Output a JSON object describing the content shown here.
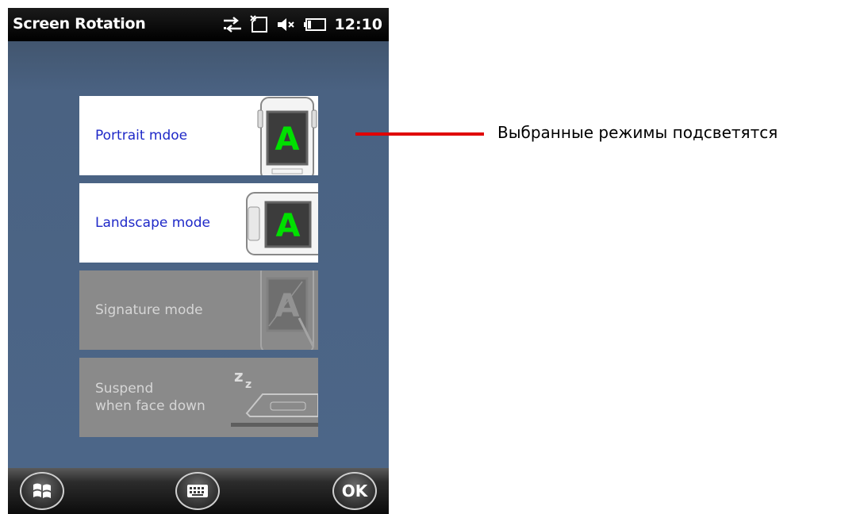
{
  "statusbar": {
    "title": "Screen Rotation",
    "time": "12:10",
    "icons": [
      "connectivity-icon",
      "no-sim-icon",
      "speaker-muted-icon",
      "battery-icon"
    ]
  },
  "modes": [
    {
      "label": "Portrait mdoe",
      "state": "highlighted",
      "art": "portrait-device-icon"
    },
    {
      "label": "Landscape mode",
      "state": "highlighted",
      "art": "landscape-device-icon"
    },
    {
      "label": "Signature mode",
      "state": "inactive",
      "art": "signature-device-icon"
    },
    {
      "label": "Suspend\nwhen face down",
      "state": "inactive",
      "art": "face-down-sleep-icon"
    }
  ],
  "appbar": {
    "start_icon": "windows-start-icon",
    "keyboard_icon": "keyboard-icon",
    "ok_label": "OK"
  },
  "callout": {
    "text": "Выбранные режимы подсветятся",
    "line_color": "#e00000"
  },
  "colors": {
    "background": "#4c6688",
    "highlight_text": "#1f29c8",
    "inactive_tile": "#8a8a8a",
    "screen_letter": "#00e000"
  }
}
